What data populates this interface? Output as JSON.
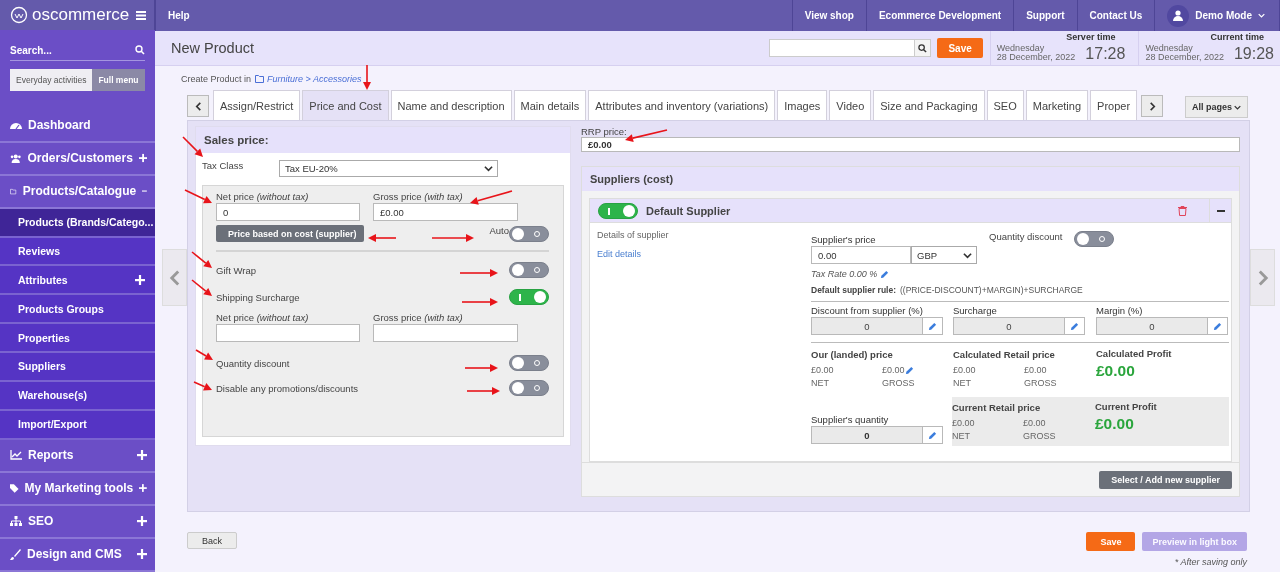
{
  "header": {
    "logo": "oscommerce",
    "help": "Help",
    "links": [
      "View shop",
      "Ecommerce Development",
      "Support",
      "Contact Us"
    ],
    "user": "Demo Mode"
  },
  "sidebar": {
    "search_placeholder": "Search...",
    "modes": [
      {
        "label": "Everyday activities",
        "selected": false
      },
      {
        "label": "Full menu",
        "selected": true
      }
    ],
    "items": [
      {
        "label": "Dashboard",
        "kind": "link"
      },
      {
        "label": "Orders/Customers",
        "kind": "group",
        "expanded": false
      },
      {
        "label": "Products/Catalogue",
        "kind": "group",
        "expanded": true,
        "children": [
          {
            "label": "Products (Brands/Catego...",
            "selected": true,
            "kind": "link"
          },
          {
            "label": "Reviews",
            "selected": false,
            "kind": "link"
          },
          {
            "label": "Attributes",
            "selected": false,
            "kind": "group",
            "expanded": false
          },
          {
            "label": "Products Groups",
            "selected": false,
            "kind": "link"
          },
          {
            "label": "Properties",
            "selected": false,
            "kind": "link"
          },
          {
            "label": "Suppliers",
            "selected": false,
            "kind": "link"
          },
          {
            "label": "Warehouse(s)",
            "selected": false,
            "kind": "link"
          },
          {
            "label": "Import/Export",
            "selected": false,
            "kind": "link"
          }
        ]
      },
      {
        "label": "Reports",
        "kind": "group",
        "expanded": false
      },
      {
        "label": "My Marketing tools",
        "kind": "group",
        "expanded": false
      },
      {
        "label": "SEO",
        "kind": "group",
        "expanded": false
      },
      {
        "label": "Design and CMS",
        "kind": "group",
        "expanded": false
      }
    ]
  },
  "page": {
    "title": "New Product",
    "save": "Save",
    "server_time": {
      "label": "Server time",
      "day": "Wednesday",
      "date": "28 December, 2022",
      "time": "17:28"
    },
    "current_time": {
      "label": "Current time",
      "day": "Wednesday",
      "date": "28 December, 2022",
      "time": "19:28"
    }
  },
  "breadcrumb": {
    "prefix": "Create Product in",
    "path": "Furniture > Accessories"
  },
  "tabs": [
    {
      "label": "Assign/Restrict",
      "selected": false
    },
    {
      "label": "Price and Cost",
      "selected": true
    },
    {
      "label": "Name and description",
      "selected": false
    },
    {
      "label": "Main details",
      "selected": false
    },
    {
      "label": "Attributes and inventory (variations)",
      "selected": false
    },
    {
      "label": "Images",
      "selected": false
    },
    {
      "label": "Video",
      "selected": false
    },
    {
      "label": "Size and Packaging",
      "selected": false
    },
    {
      "label": "SEO",
      "selected": false
    },
    {
      "label": "Marketing",
      "selected": false
    },
    {
      "label": "Proper",
      "selected": false
    }
  ],
  "all_pages": "All pages",
  "sales": {
    "title": "Sales price:",
    "tax_class": {
      "label": "Tax Class",
      "value": "Tax EU-20%"
    },
    "net": {
      "label": "Net price *(without tax)*",
      "value": "0"
    },
    "gross": {
      "label": "Gross price *(with tax)*",
      "value": "£0.00"
    },
    "cost_button": "Price based on cost (supplier)",
    "auto": {
      "label": "Auto",
      "on": false
    },
    "gift_wrap": {
      "label": "Gift Wrap",
      "on": false
    },
    "shipping": {
      "label": "Shipping Surcharge",
      "on": true
    },
    "surcharge_net": {
      "label": "Net price *(without tax)*"
    },
    "surcharge_gross": {
      "label": "Gross price *(with tax)*"
    },
    "options": [
      {
        "label": "Quantity discount",
        "on": false
      },
      {
        "label": "Disable any promotions/discounts",
        "on": false
      }
    ]
  },
  "rrp": {
    "label": "RRP price:",
    "value": "£0.00"
  },
  "suppliers": {
    "title": "Suppliers (cost)",
    "supplier": {
      "on": true,
      "name": "Default Supplier",
      "details": "Details of supplier",
      "edit": "Edit details",
      "price_label": "Supplier's price",
      "price": "0.00",
      "currency": "GBP",
      "qty_discount": {
        "label": "Quantity discount",
        "on": false
      },
      "tax_rate": "Tax Rate 0.00 %",
      "rule_label": "Default supplier rule:",
      "rule": "((PRICE-DISCOUNT)+MARGIN)+SURCHARGE",
      "adjustments": [
        {
          "label": "Discount from supplier (%)",
          "value": "0"
        },
        {
          "label": "Surcharge",
          "value": "0"
        },
        {
          "label": "Margin (%)",
          "value": "0"
        }
      ],
      "landed": {
        "label": "Our (landed) price",
        "net": "£0.00",
        "gross": "£0.00",
        "net_label": "NET",
        "gross_label": "GROSS"
      },
      "calc_retail": {
        "label": "Calculated Retail price",
        "net": "£0.00",
        "gross": "£0.00",
        "net_label": "NET",
        "gross_label": "GROSS"
      },
      "calc_profit": {
        "label": "Calculated Profit",
        "value": "£0.00"
      },
      "quantity": {
        "label": "Supplier's quantity",
        "value": "0"
      },
      "cur_retail": {
        "label": "Current Retail price",
        "net": "£0.00",
        "gross": "£0.00",
        "net_label": "NET",
        "gross_label": "GROSS"
      },
      "cur_profit": {
        "label": "Current Profit",
        "value": "£0.00"
      }
    },
    "add_button": "Select / Add new supplier"
  },
  "footer": {
    "back": "Back",
    "save": "Save",
    "preview": {
      "label": "Preview in light box",
      "disabled": true
    },
    "note": "* After saving only"
  }
}
